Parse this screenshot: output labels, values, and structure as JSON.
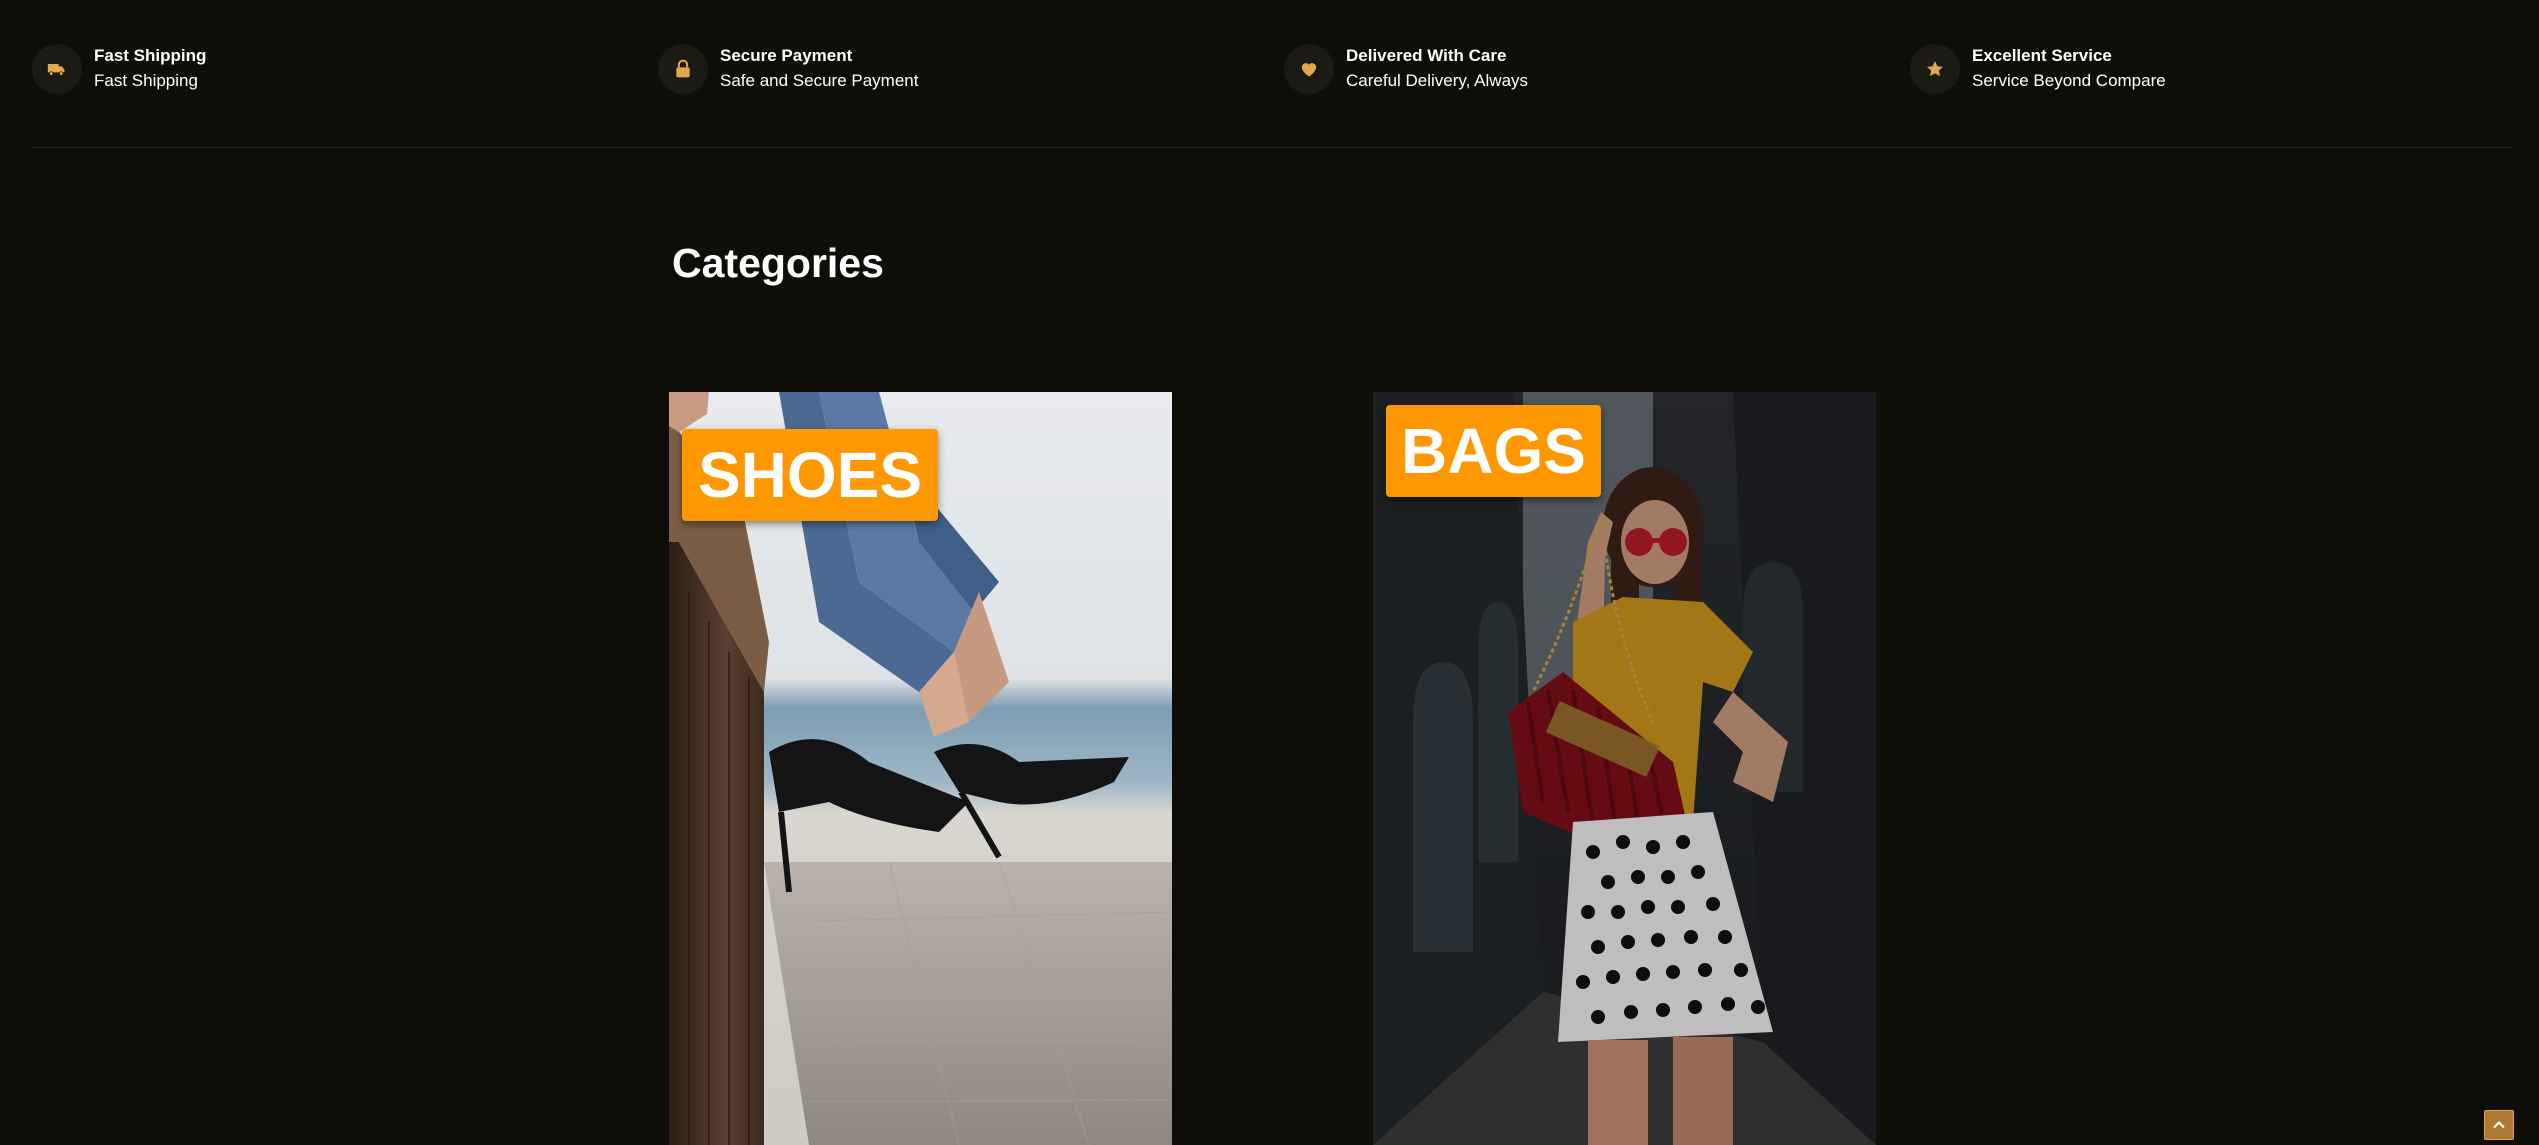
{
  "features": [
    {
      "icon": "truck-icon",
      "title": "Fast Shipping",
      "subtitle": "Fast Shipping"
    },
    {
      "icon": "lock-icon",
      "title": "Secure Payment",
      "subtitle": "Safe and Secure Payment"
    },
    {
      "icon": "heart-icon",
      "title": "Delivered With Care",
      "subtitle": "Careful Delivery, Always"
    },
    {
      "icon": "star-icon",
      "title": "Excellent Service",
      "subtitle": "Service Beyond Compare"
    }
  ],
  "categories_section": {
    "title": "Categories",
    "items": [
      {
        "label": "SHOES",
        "image": "high-heels-photo"
      },
      {
        "label": "BAGS",
        "image": "woman-with-red-bag-photo"
      }
    ]
  },
  "scroll_top": {
    "icon": "chevron-up-icon"
  },
  "colors": {
    "background": "#0e0d08",
    "accent": "#ff9800",
    "icon_gold": "#e3a84c",
    "text": "#ffffff"
  }
}
